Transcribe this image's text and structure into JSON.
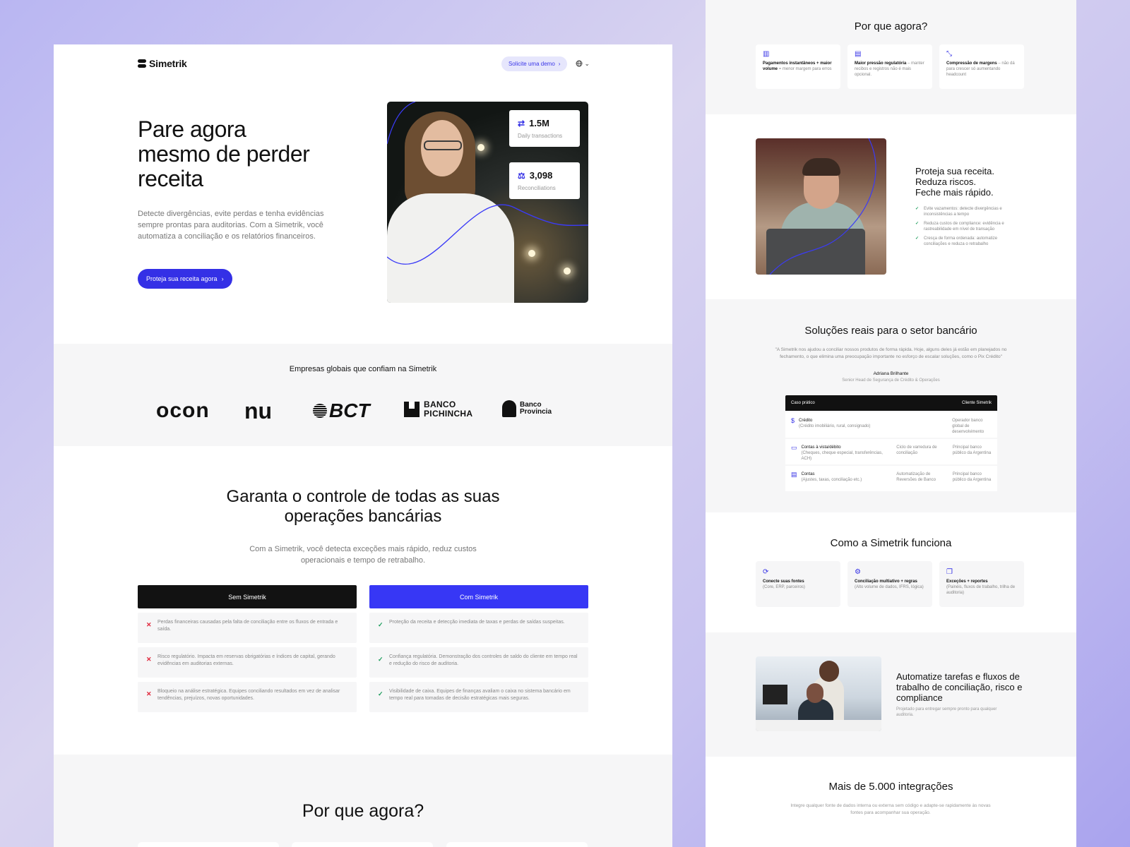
{
  "colors": {
    "accent": "#3430e6",
    "black": "#111111",
    "muted": "#777777",
    "bg_soft": "#f6f6f7",
    "success": "#1a9c5a",
    "error": "#e0263b"
  },
  "nav": {
    "brand": "Simetrik",
    "demo_label": "Solicite uma demo",
    "demo_icon": "chevron-right-icon",
    "lang_icon": "globe-icon"
  },
  "hero": {
    "title": "Pare agora mesmo de perder receita",
    "description": "Detecte divergências, evite perdas e tenha evidências sempre prontas para auditorias. Com a Simetrik, você automatiza a conciliação e os relatórios financeiros.",
    "cta": "Proteja sua receita agora",
    "stats": [
      {
        "icon": "transfer-icon",
        "value": "1.5M",
        "label": "Daily transactions"
      },
      {
        "icon": "scale-icon",
        "value": "3,098",
        "label": "Reconciliations"
      }
    ]
  },
  "trust": {
    "title": "Empresas globais que confiam na Simetrik",
    "logos": [
      "ocon",
      "nu",
      "BCT",
      "BANCO PICHINCHA",
      "Banco Provincia"
    ]
  },
  "control": {
    "title_line1": "Garanta o controle de todas as suas",
    "title_line2": "operações bancárias",
    "description_line1": "Com a Simetrik, você detecta exceções mais rápido, reduz custos",
    "description_line2": "operacionais e tempo de retrabalho.",
    "without_label": "Sem Simetrik",
    "with_label": "Com Simetrik",
    "without": [
      "Perdas financeiras causadas pela falta de conciliação entre os fluxos de entrada e saída.",
      "Risco regulatório. Impacta em reservas obrigatórias e índices de capital, gerando evidências em auditorias externas.",
      "Bloqueio na análise estratégica. Equipes conciliando resultados em vez de analisar tendências, prejuízos, novas oportunidades."
    ],
    "with": [
      "Proteção da receita e detecção imediata de taxas e perdas de saídas suspeitas.",
      "Confiança regulatória. Demonstração dos controles de saldo do cliente em tempo real e redução do risco de auditoria.",
      "Visibilidade de caixa. Equipes de finanças avaliam o caixa no sistema bancário em tempo real para tomadas de decisão estratégicas mais seguras."
    ]
  },
  "why": {
    "title": "Por que agora?",
    "cards": [
      {
        "icon": "chart-icon",
        "title": "Pagamentos instantâneos + maior volume",
        "text": "= menor margem para erros"
      },
      {
        "icon": "document-icon",
        "title": "Maior pressão regulatória",
        "text": "– manter recibos e registros não é mais opcional."
      },
      {
        "icon": "compress-icon",
        "title": "Compressão de margens",
        "text": "– não dá para crescer só aumentando headcount"
      }
    ]
  },
  "protect": {
    "title_lines": [
      "Proteja sua receita.",
      "Reduza riscos.",
      "Feche mais rápido."
    ],
    "items": [
      "Evite vazamentos: detecte divergências e inconsistências a tempo",
      "Reduza custos de compliance: evidência e rastreabilidade em nível de transação",
      "Cresça de forma ordenada: automatize conciliações e reduza o retrabalho"
    ]
  },
  "solutions": {
    "title": "Soluções reais para o setor bancário",
    "quote": "\"A Simetrik nos ajudou a conciliar nossos produtos de forma rápida. Hoje, alguns deles já estão em planejados no fechamento, o que elimina uma preocupação importante no esforço de escalar soluções, como o Pix Crédito\"",
    "author": "Adriana Brilhante",
    "author_role": "Senior Head de Segurança de Crédito & Operações",
    "table_head_left": "Caso prático",
    "table_head_right": "Cliente Simetrik",
    "rows": [
      {
        "icon": "dollar-icon",
        "title": "Crédito",
        "sub": "(Crédito imobiliário, rural, consignado)",
        "mid": "",
        "right": "Operador banco global de desenvolvimento"
      },
      {
        "icon": "card-icon",
        "title": "Contas à vista/débito",
        "sub": "(Cheques, cheque especial, transferências, ACH)",
        "mid": "Ciclo de varredura de conciliação",
        "right": "Principal banco público da Argentina"
      },
      {
        "icon": "doc-icon",
        "title": "Contas",
        "sub": "(Ajustes, taxas, conciliação etc.)",
        "mid": "Automatização de Reversões de Banco",
        "right": "Principal banco público da Argentina"
      }
    ]
  },
  "how": {
    "title": "Como a Simetrik funciona",
    "cards": [
      {
        "icon": "sync-icon",
        "title": "Conecte suas fontes",
        "text": "(Core, ERP, parceiros)"
      },
      {
        "icon": "settings-icon",
        "title": "Conciliação multiativo + regras",
        "text": "(Alto volume de dados, IFRS, lógica)"
      },
      {
        "icon": "layers-icon",
        "title": "Exceções + reportes",
        "text": "(Painéis, fluxos de trabalho, trilha de auditoria)"
      }
    ]
  },
  "automate": {
    "title": "Automatize tarefas e fluxos de trabalho de conciliação, risco e compliance",
    "description": "Projetado para entregar sempre pronto para qualquer auditoria."
  },
  "integrations": {
    "title": "Mais de 5.000 integrações",
    "description": "Integre qualquer fonte de dados interna ou externa sem código e adapte-se rapidamente às novas fontes para acompanhar sua operação."
  }
}
